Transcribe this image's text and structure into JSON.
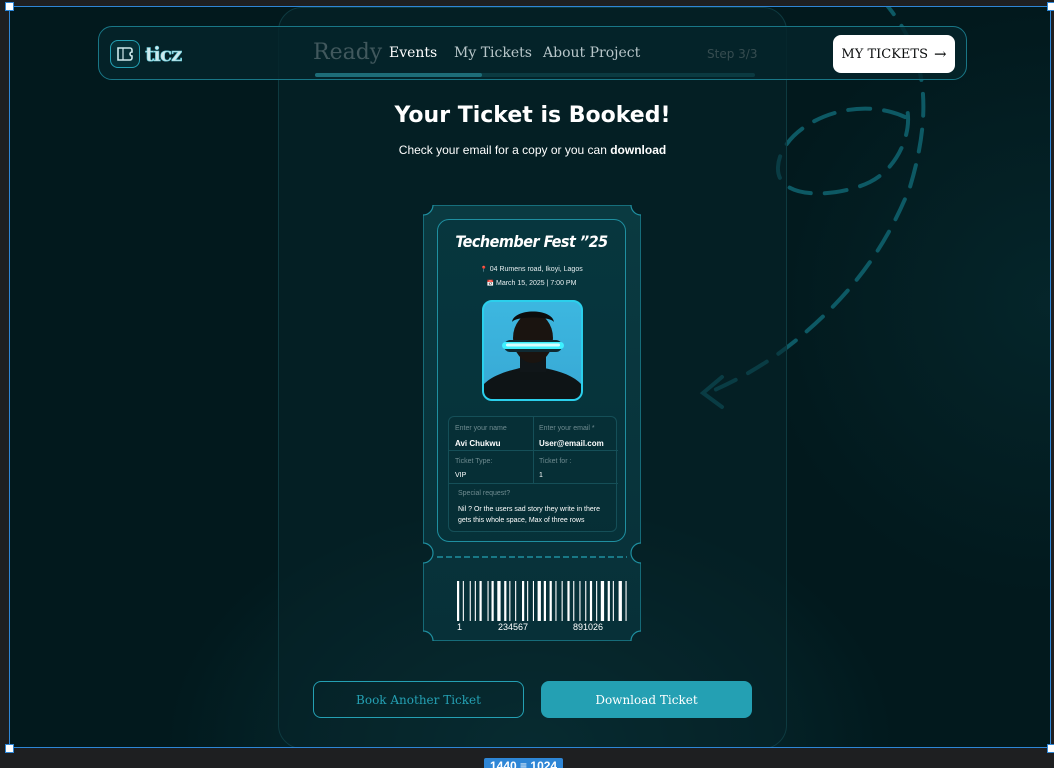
{
  "nav": {
    "logo_text": "ticz",
    "links": [
      "Events",
      "My Tickets",
      "About Project"
    ],
    "my_tickets_button": "MY TICKETS",
    "my_tickets_arrow": "→"
  },
  "ghost": {
    "heading": "Ready",
    "step": "Step 3/3",
    "progress_percent": 38
  },
  "confirmation": {
    "title": "Your Ticket is Booked!",
    "subtitle_prefix": "Check your email for a copy or you can ",
    "subtitle_link": "download"
  },
  "ticket": {
    "event_name": "Techember Fest ”25",
    "location_icon": "📍",
    "location": "04 Rumens road, Ikoyi, Lagos",
    "date_icon": "📅",
    "date": "March 15, 2025 | 7:00 PM",
    "fields": {
      "name_label": "Enter your name",
      "name_value": "Avi Chukwu",
      "email_label": "Enter your email *",
      "email_value": "User@email.com",
      "type_label": "Ticket Type:",
      "type_value": "VIP",
      "for_label": "Ticket for :",
      "for_value": "1",
      "request_label": "Special request?",
      "request_value": "Nil ? Or the users sad story they write in there gets this whole space, Max of three rows"
    },
    "barcode_numbers": [
      "1",
      "234567",
      "891026"
    ]
  },
  "actions": {
    "book_another": "Book Another Ticket",
    "download": "Download Ticket"
  },
  "canvas": {
    "size_label_w": "1440",
    "size_label_h": "1024"
  },
  "colors": {
    "accent": "#24A0B3",
    "background": "#02191D",
    "selection": "#2E86D6"
  }
}
